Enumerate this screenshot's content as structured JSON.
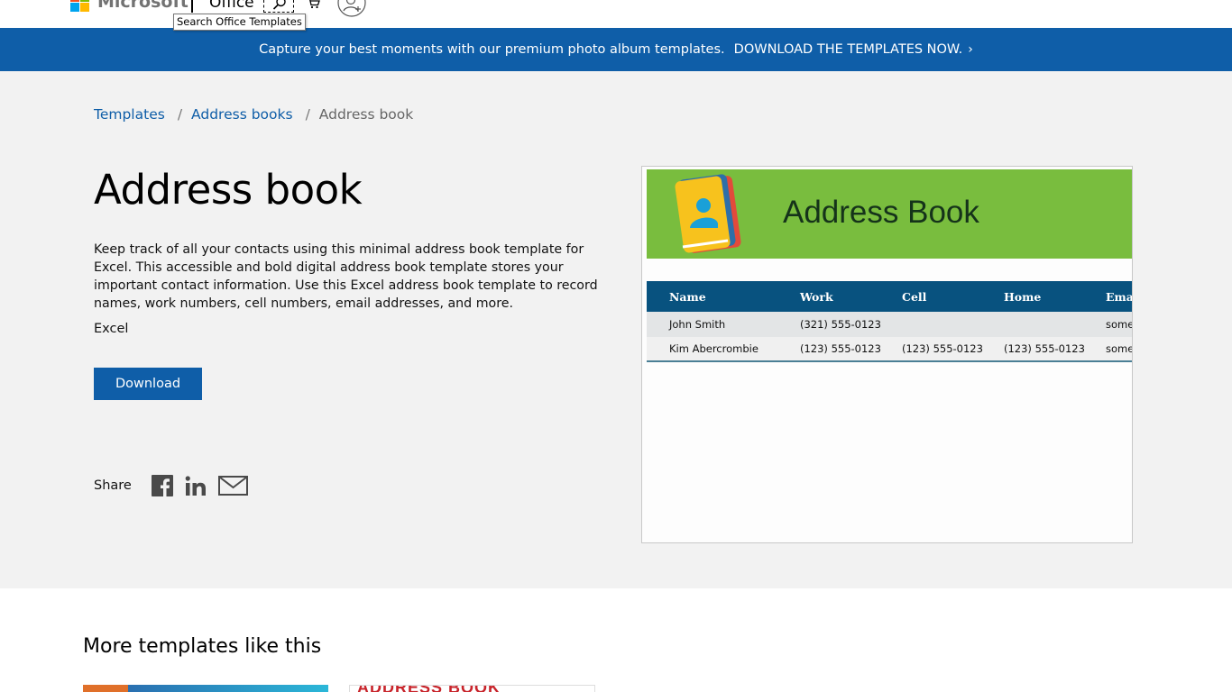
{
  "header": {
    "brand": "Microsoft",
    "product": "Office",
    "search_tooltip": "Search Office Templates",
    "icons": [
      "search-icon",
      "cart-icon",
      "account-icon"
    ]
  },
  "banner": {
    "text": "Capture your best moments with our premium photo album templates.",
    "cta": "DOWNLOAD THE TEMPLATES NOW.",
    "chevron": "›"
  },
  "breadcrumb": {
    "items": [
      "Templates",
      "Address books"
    ],
    "current": "Address book",
    "separator": "/"
  },
  "main": {
    "title": "Address book",
    "description": "Keep track of all your contacts using this minimal address book template for Excel. This accessible and bold digital address book template stores your important contact information. Use this Excel address book template to record names, work numbers, cell numbers, email addresses, and more.",
    "app": "Excel",
    "download_label": "Download",
    "share_label": "Share",
    "share_icons": [
      "facebook-icon",
      "linkedin-icon",
      "email-icon"
    ]
  },
  "preview": {
    "title": "Address Book",
    "columns": [
      "Name",
      "Work",
      "Cell",
      "Home",
      "Emai"
    ],
    "rows": [
      [
        "John Smith",
        "(321) 555-0123",
        "",
        "",
        "some"
      ],
      [
        "Kim Abercrombie",
        "(123) 555-0123",
        "(123) 555-0123",
        "(123) 555-0123",
        "some"
      ]
    ]
  },
  "more": {
    "title": "More templates like this",
    "thumb2_text": "ADDRESS BOOK"
  },
  "colors": {
    "brand_blue": "#0f5ea8",
    "hero_bg": "#f2f2f2",
    "preview_green": "#79bd3e",
    "preview_header": "#08527f"
  }
}
